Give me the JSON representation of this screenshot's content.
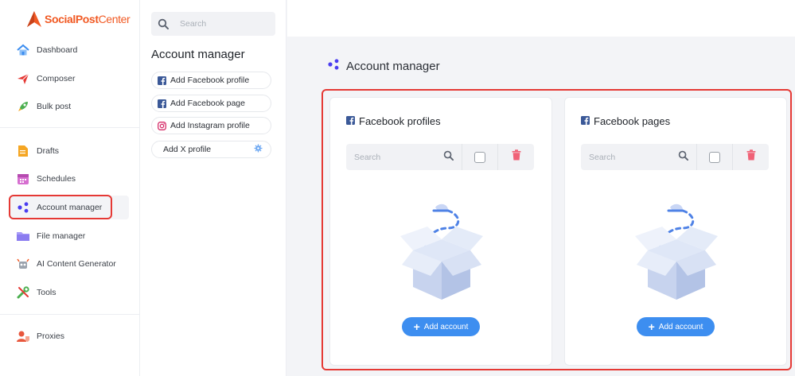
{
  "brand": {
    "name_part1": "SocialPost",
    "name_part2": "Center"
  },
  "sidebar": {
    "items": [
      {
        "label": "Dashboard",
        "icon": "house-icon"
      },
      {
        "label": "Composer",
        "icon": "paper-plane-icon"
      },
      {
        "label": "Bulk post",
        "icon": "rocket-icon"
      },
      {
        "label": "Drafts",
        "icon": "document-icon"
      },
      {
        "label": "Schedules",
        "icon": "calendar-icon"
      },
      {
        "label": "Account manager",
        "icon": "share-nodes-icon"
      },
      {
        "label": "File manager",
        "icon": "folder-icon"
      },
      {
        "label": "AI Content Generator",
        "icon": "robot-icon"
      },
      {
        "label": "Tools",
        "icon": "tools-icon"
      },
      {
        "label": "Proxies",
        "icon": "user-shield-icon"
      }
    ]
  },
  "submenu": {
    "search_placeholder": "Search",
    "title": "Account manager",
    "buttons": [
      {
        "label": "Add Facebook profile",
        "icon": "facebook-icon"
      },
      {
        "label": "Add Facebook page",
        "icon": "facebook-icon"
      },
      {
        "label": "Add Instagram profile",
        "icon": "instagram-icon"
      },
      {
        "label": "Add X profile",
        "icon": "gear-icon"
      }
    ]
  },
  "main": {
    "title": "Account manager",
    "cards": [
      {
        "title": "Facebook profiles",
        "search_placeholder": "Search",
        "add_label": "Add account"
      },
      {
        "title": "Facebook pages",
        "search_placeholder": "Search",
        "add_label": "Add account"
      }
    ]
  },
  "colors": {
    "accent": "#3d8ef0",
    "brand": "#f15a24",
    "highlight": "#e53935",
    "delete": "#f06277"
  }
}
